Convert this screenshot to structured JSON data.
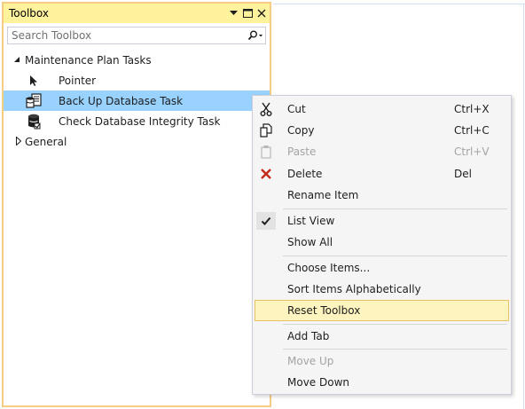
{
  "toolbox": {
    "title": "Toolbox",
    "buttons": {
      "dropdown": "▾",
      "maximize": "□",
      "close": "✕"
    },
    "search": {
      "placeholder": "Search Toolbox",
      "value": ""
    },
    "groups": [
      {
        "label": "Maintenance Plan Tasks",
        "expanded": true,
        "items": [
          {
            "label": "Pointer",
            "icon": "pointer-icon"
          },
          {
            "label": "Back Up Database Task",
            "icon": "backup-database-icon"
          },
          {
            "label": "Check Database Integrity Task",
            "icon": "check-database-icon"
          }
        ]
      },
      {
        "label": "General",
        "expanded": false
      }
    ]
  },
  "context_menu": {
    "items": [
      {
        "label": "Cut",
        "shortcut": "Ctrl+X",
        "icon": "scissors-icon",
        "enabled": true
      },
      {
        "label": "Copy",
        "shortcut": "Ctrl+C",
        "icon": "copy-icon",
        "enabled": true
      },
      {
        "label": "Paste",
        "shortcut": "Ctrl+V",
        "icon": "paste-icon",
        "enabled": false
      },
      {
        "label": "Delete",
        "shortcut": "Del",
        "icon": "delete-icon",
        "enabled": true
      },
      {
        "label": "Rename Item",
        "enabled": true
      },
      {
        "label": "List View",
        "icon": "checkmark-icon",
        "checked": true,
        "enabled": true
      },
      {
        "label": "Show All",
        "enabled": true
      },
      {
        "label": "Choose Items...",
        "enabled": true
      },
      {
        "label": "Sort Items Alphabetically",
        "enabled": true
      },
      {
        "label": "Reset Toolbox",
        "enabled": true,
        "highlighted": true
      },
      {
        "label": "Add Tab",
        "enabled": true
      },
      {
        "label": "Move Up",
        "enabled": false
      },
      {
        "label": "Move Down",
        "enabled": true
      }
    ]
  },
  "colors": {
    "title_bar": "#fff29d",
    "panel_border": "#f5cc84",
    "selected_row": "#cce8ff",
    "menu_highlight": "#fdf4bf",
    "delete_red": "#c42b1c"
  }
}
